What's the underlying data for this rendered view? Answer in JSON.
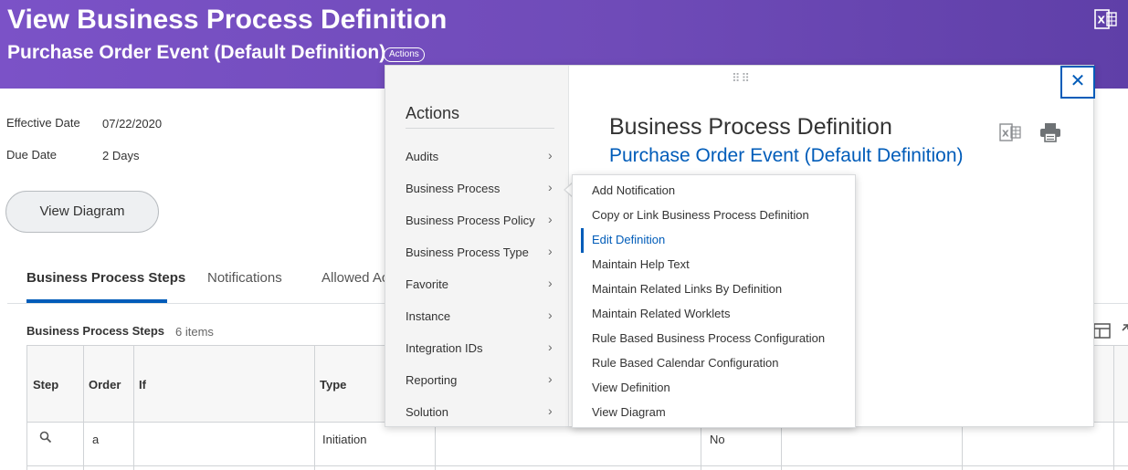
{
  "header": {
    "title": "View Business Process Definition",
    "subtitle": "Purchase Order Event (Default Definition)",
    "actions_label": "Actions",
    "background": "#7b52c7"
  },
  "fields": [
    {
      "label": "Effective Date",
      "value": "07/22/2020"
    },
    {
      "label": "Due Date",
      "value": "2 Days"
    }
  ],
  "view_diagram_label": "View Diagram",
  "tabs": [
    {
      "label": "Business Process Steps",
      "active": true
    },
    {
      "label": "Notifications",
      "active": false
    },
    {
      "label": "Allowed Ac",
      "active": false
    }
  ],
  "grid": {
    "title": "Business Process Steps",
    "count": "6 items",
    "columns": [
      "Step",
      "Order",
      "If",
      "Type"
    ],
    "rows": [
      {
        "step_icon": "search-icon",
        "order": "a",
        "if": "",
        "type": "Initiation",
        "extra": "No"
      }
    ]
  },
  "popup": {
    "heading": "Actions",
    "title": "Business Process Definition",
    "subtitle": "Purchase Order Event (Default Definition)",
    "categories": [
      "Audits",
      "Business Process",
      "Business Process Policy",
      "Business Process Type",
      "Favorite",
      "Instance",
      "Integration IDs",
      "Reporting",
      "Solution"
    ],
    "submenu": [
      "Add Notification",
      "Copy or Link Business Process Definition",
      "Edit Definition",
      "Maintain Help Text",
      "Maintain Related Links By Definition",
      "Maintain Related Worklets",
      "Rule Based Business Process Configuration",
      "Rule Based Calendar Configuration",
      "View Definition",
      "View Diagram"
    ],
    "selected_submenu": "Edit Definition",
    "close_glyph": "✕",
    "drag_glyph": "⠿⠿",
    "accent": "#005cb9"
  }
}
